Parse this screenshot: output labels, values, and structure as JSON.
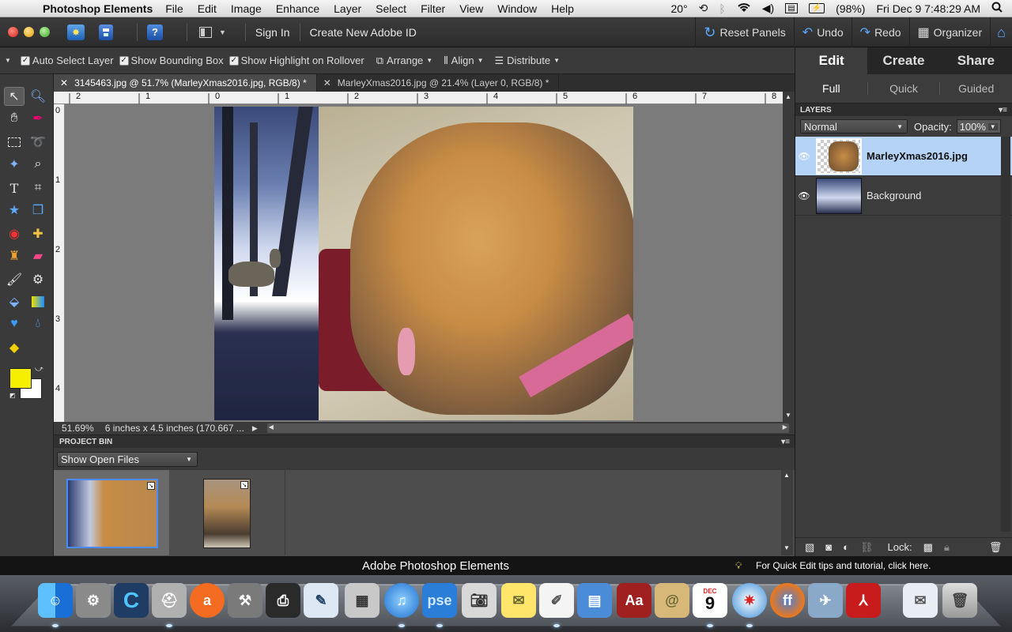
{
  "menubar": {
    "app_name": "Photoshop Elements",
    "items": [
      "File",
      "Edit",
      "Image",
      "Enhance",
      "Layer",
      "Select",
      "Filter",
      "View",
      "Window",
      "Help"
    ],
    "temperature": "20°",
    "battery": "(98%)",
    "clock": "Fri Dec 9  7:48:29 AM"
  },
  "toolbar": {
    "sign_in": "Sign In",
    "create_id": "Create New Adobe ID",
    "reset_panels": "Reset Panels",
    "undo": "Undo",
    "redo": "Redo",
    "organizer": "Organizer"
  },
  "options": {
    "auto_select": "Auto Select Layer",
    "bounding_box": "Show Bounding Box",
    "highlight": "Show Highlight on Rollover",
    "arrange": "Arrange",
    "align": "Align",
    "distribute": "Distribute"
  },
  "tabs": [
    {
      "label": "3145463.jpg @ 51.7% (MarleyXmas2016.jpg, RGB/8) *"
    },
    {
      "label": "MarleyXmas2016.jpg @ 21.4% (Layer 0, RGB/8) *"
    }
  ],
  "ruler_h": [
    "2",
    "1",
    "0",
    "1",
    "2",
    "3",
    "4",
    "5",
    "6",
    "7",
    "8"
  ],
  "ruler_v": [
    "0",
    "1",
    "2",
    "3",
    "4"
  ],
  "status": {
    "zoom": "51.69%",
    "doc_size": "6 inches x 4.5 inches (170.667 ..."
  },
  "project_bin": {
    "title": "PROJECT BIN",
    "filter": "Show Open Files"
  },
  "panel": {
    "modes": [
      "Edit",
      "Create",
      "Share"
    ],
    "submodes": [
      "Full",
      "Quick",
      "Guided"
    ],
    "layers_title": "LAYERS",
    "blend_mode": "Normal",
    "opacity_label": "Opacity:",
    "opacity_value": "100%",
    "layers": [
      {
        "name": "MarleyXmas2016.jpg",
        "selected": true
      },
      {
        "name": "Background",
        "selected": false
      }
    ],
    "lock_label": "Lock:"
  },
  "app_status": {
    "title": "Adobe Photoshop Elements",
    "tip": "For Quick Edit tips and tutorial, click here."
  },
  "dock": {
    "calendar_month": "DEC",
    "calendar_day": "9",
    "pse_label": "pse",
    "dictionary_label": "Aa"
  },
  "colors": {
    "foreground": "#f5ee00",
    "background": "#ffffff",
    "layer_selected": "#b5d3f7"
  }
}
